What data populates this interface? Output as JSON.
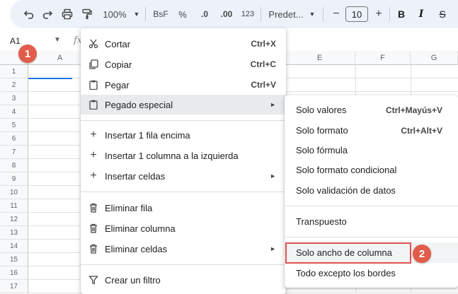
{
  "toolbar": {
    "zoom": "100%",
    "format_bsf": "BsF",
    "format_percent": "%",
    "decrease_decimals": ".0",
    "increase_decimals": ".00",
    "number_format": "123",
    "font_family": "Predet...",
    "font_size": "10",
    "minus": "−",
    "plus": "+",
    "bold": "B",
    "italic": "I",
    "strike": "S"
  },
  "formula_bar": {
    "name_box": "A1",
    "fx": "fx"
  },
  "columns": [
    "A",
    "E",
    "F",
    "G"
  ],
  "rows": [
    "1",
    "2",
    "3",
    "4",
    "5",
    "6",
    "7",
    "8",
    "9",
    "10",
    "11",
    "12",
    "13",
    "14",
    "15",
    "16",
    "17"
  ],
  "context_menu": {
    "items": [
      {
        "label": "Cortar",
        "shortcut": "Ctrl+X",
        "icon": "scissors-icon"
      },
      {
        "label": "Copiar",
        "shortcut": "Ctrl+C",
        "icon": "copy-icon"
      },
      {
        "label": "Pegar",
        "shortcut": "Ctrl+V",
        "icon": "clipboard-icon"
      },
      {
        "label": "Pegado especial",
        "arrow": "►",
        "icon": "clipboard-icon"
      },
      {
        "label": "Insertar 1 fila encima",
        "icon": "plus-icon"
      },
      {
        "label": "Insertar 1 columna a la izquierda",
        "icon": "plus-icon"
      },
      {
        "label": "Insertar celdas",
        "arrow": "►",
        "icon": "plus-icon"
      },
      {
        "label": "Eliminar fila",
        "icon": "trash-icon"
      },
      {
        "label": "Eliminar columna",
        "icon": "trash-icon"
      },
      {
        "label": "Eliminar celdas",
        "arrow": "►",
        "icon": "trash-icon"
      },
      {
        "label": "Crear un filtro",
        "icon": "filter-icon"
      }
    ]
  },
  "submenu": {
    "items": [
      {
        "label": "Solo valores",
        "shortcut": "Ctrl+Mayús+V"
      },
      {
        "label": "Solo formato",
        "shortcut": "Ctrl+Alt+V"
      },
      {
        "label": "Solo fórmula"
      },
      {
        "label": "Solo formato condicional"
      },
      {
        "label": "Solo validación de datos"
      },
      {
        "label": "Transpuesto"
      },
      {
        "label": "Solo ancho de columna"
      },
      {
        "label": "Todo excepto los bordes"
      }
    ]
  },
  "badges": [
    "1",
    "2"
  ],
  "colors": {
    "highlight": "#e25050",
    "badge": "#e25c4a",
    "selection": "#1a73e8",
    "toolbar_bg": "#edf2fa"
  }
}
